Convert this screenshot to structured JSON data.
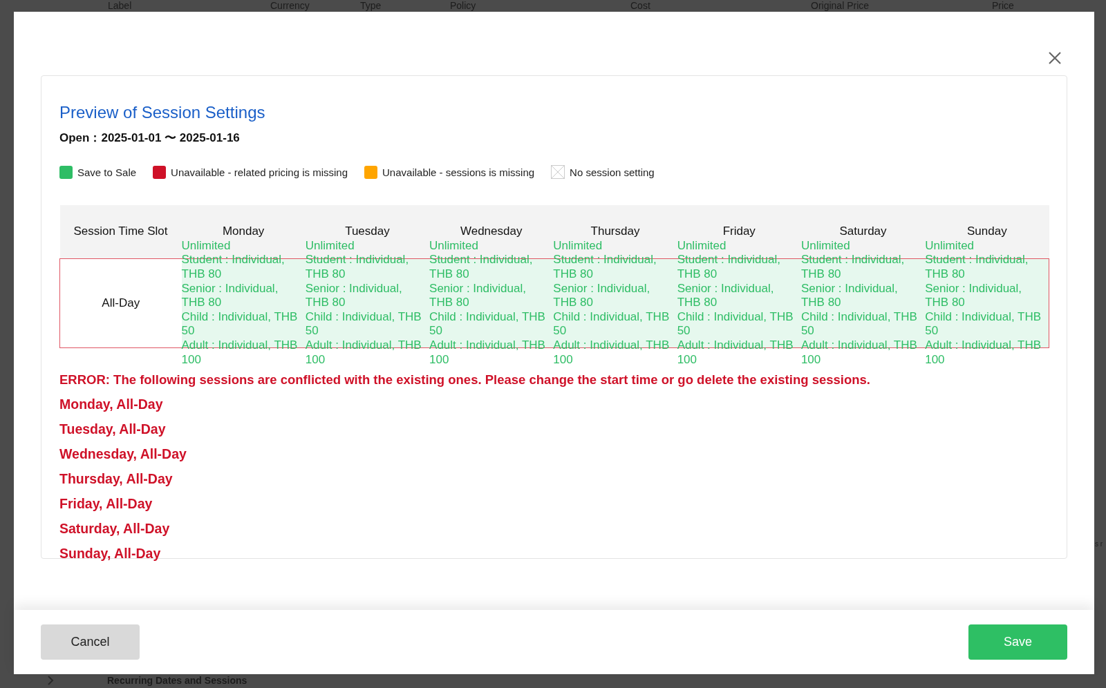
{
  "background": {
    "columns": [
      "Label",
      "Currency",
      "Type",
      "Policy",
      "Cost",
      "Original Price",
      "Price"
    ],
    "section_title": "Recurring Dates and Sessions",
    "side_fragment": "s r"
  },
  "dialog": {
    "title": "Preview of Session Settings",
    "open_range": "Open：2025-01-01 〜 2025-01-16",
    "legend": [
      {
        "kind": "swatch",
        "color": "#2ebd65",
        "label": "Save to Sale"
      },
      {
        "kind": "swatch",
        "color": "#cf1128",
        "label": "Unavailable - related pricing is missing"
      },
      {
        "kind": "swatch",
        "color": "#ffa500",
        "label": "Unavailable - sessions is missing"
      },
      {
        "kind": "none",
        "label": "No session setting"
      }
    ],
    "table": {
      "corner": "Session Time Slot",
      "days": [
        "Monday",
        "Tuesday",
        "Wednesday",
        "Thursday",
        "Friday",
        "Saturday",
        "Sunday"
      ],
      "rows": [
        {
          "slot": "All-Day",
          "conflict": true,
          "cells": [
            {
              "kind": "sale",
              "lines": [
                "Unlimited",
                "Student : Individual, THB 80",
                "Senior : Individual, THB 80",
                "Child : Individual, THB 50",
                "Adult : Individual, THB 100"
              ]
            },
            {
              "kind": "sale",
              "lines": [
                "Unlimited",
                "Student : Individual, THB 80",
                "Senior : Individual, THB 80",
                "Child : Individual, THB 50",
                "Adult : Individual, THB 100"
              ]
            },
            {
              "kind": "sale",
              "lines": [
                "Unlimited",
                "Student : Individual, THB 80",
                "Senior : Individual, THB 80",
                "Child : Individual, THB 50",
                "Adult : Individual, THB 100"
              ]
            },
            {
              "kind": "sale",
              "lines": [
                "Unlimited",
                "Student : Individual, THB 80",
                "Senior : Individual, THB 80",
                "Child : Individual, THB 50",
                "Adult : Individual, THB 100"
              ]
            },
            {
              "kind": "sale",
              "lines": [
                "Unlimited",
                "Student : Individual, THB 80",
                "Senior : Individual, THB 80",
                "Child : Individual, THB 50",
                "Adult : Individual, THB 100"
              ]
            },
            {
              "kind": "sale",
              "lines": [
                "Unlimited",
                "Student : Individual, THB 80",
                "Senior : Individual, THB 80",
                "Child : Individual, THB 50",
                "Adult : Individual, THB 100"
              ]
            },
            {
              "kind": "sale",
              "lines": [
                "Unlimited",
                "Student : Individual, THB 80",
                "Senior : Individual, THB 80",
                "Child : Individual, THB 50",
                "Adult : Individual, THB 100"
              ]
            }
          ]
        }
      ]
    },
    "error": {
      "message": "ERROR: The following sessions are conflicted with the existing ones. Please change the start time or go delete the existing sessions.",
      "items": [
        "Monday, All-Day",
        "Tuesday, All-Day",
        "Wednesday, All-Day",
        "Thursday, All-Day",
        "Friday, All-Day",
        "Saturday, All-Day",
        "Sunday, All-Day"
      ]
    },
    "buttons": {
      "cancel": "Cancel",
      "save": "Save"
    }
  }
}
